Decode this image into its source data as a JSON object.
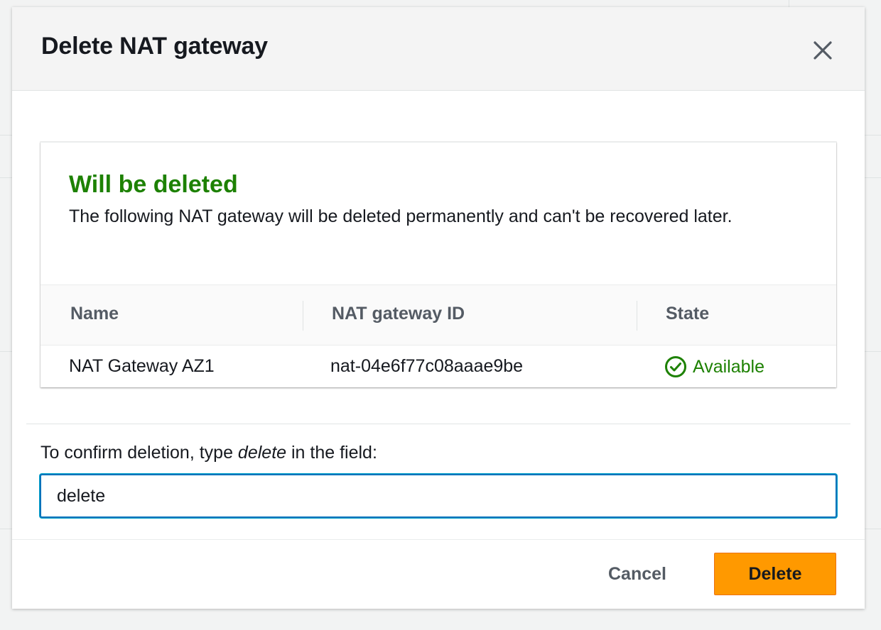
{
  "modal": {
    "title": "Delete NAT gateway",
    "close_icon": "close-icon"
  },
  "warning_panel": {
    "heading": "Will be deleted",
    "description": "The following NAT gateway will be deleted permanently and can't be recovered later.",
    "heading_color": "#1d8102"
  },
  "table": {
    "columns": [
      "Name",
      "NAT gateway ID",
      "State"
    ],
    "rows": [
      {
        "name": "NAT Gateway AZ1",
        "id": "nat-04e6f77c08aaae9be",
        "state": "Available",
        "state_icon": "check-circle-icon",
        "state_color": "#1d8102"
      }
    ]
  },
  "confirm": {
    "label_prefix": "To confirm deletion, type ",
    "label_keyword": "delete",
    "label_suffix": " in the field:",
    "input_value": "delete"
  },
  "footer": {
    "cancel_label": "Cancel",
    "delete_label": "Delete",
    "delete_color": "#ff9900"
  }
}
